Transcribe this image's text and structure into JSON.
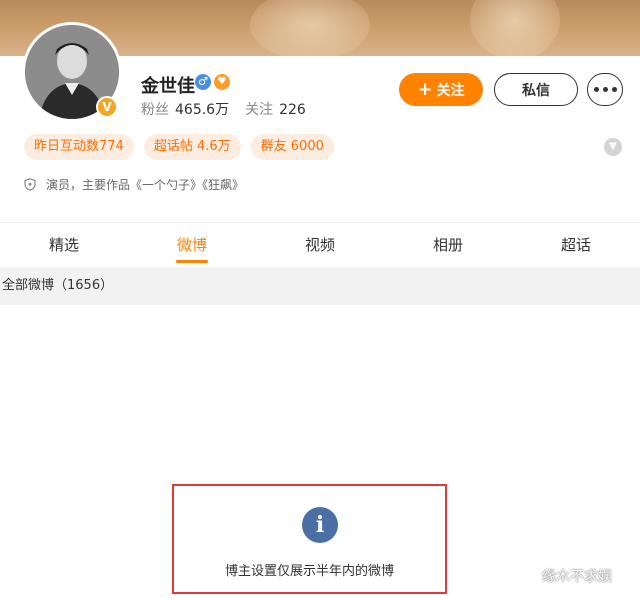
{
  "profile": {
    "name": "金世佳",
    "gender_icon": "male-icon",
    "badge_icon": "heart-badge-icon",
    "verified_icon": "verified-v-icon",
    "stats": {
      "fans_label": "粉丝",
      "fans_value": "465.6万",
      "follow_label": "关注",
      "follow_value": "226"
    }
  },
  "actions": {
    "follow_plus": "+",
    "follow_label": "关注",
    "message_label": "私信"
  },
  "tags": [
    "昨日互动数774",
    "超话帖 4.6万",
    "群友 6000"
  ],
  "bio": "演员，主要作品《一个勺子》《狂飙》",
  "tabs": [
    {
      "label": "精选",
      "active": false
    },
    {
      "label": "微博",
      "active": true
    },
    {
      "label": "视频",
      "active": false
    },
    {
      "label": "相册",
      "active": false
    },
    {
      "label": "超话",
      "active": false
    }
  ],
  "section": {
    "title": "全部微博（1656）"
  },
  "notice": {
    "icon_char": "i",
    "text": "博主设置仅展示半年内的微博"
  },
  "watermark": "缘木不求娱",
  "colors": {
    "accent": "#ff8200",
    "tag_bg": "#fdece0",
    "notice_border": "#e03a3a",
    "info_icon": "#4a6fa5"
  }
}
